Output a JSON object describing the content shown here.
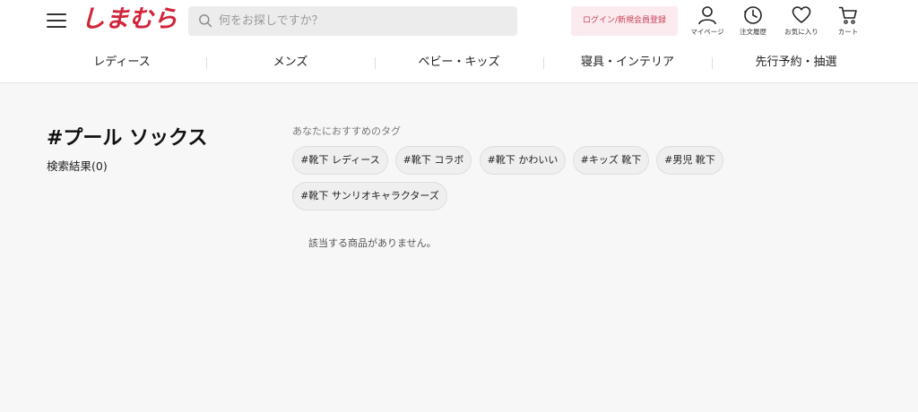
{
  "header": {
    "logo_text": "しまむら",
    "search": {
      "placeholder": "何をお探しですか？",
      "value": ""
    },
    "login_label": "ログイン/新規会員登録",
    "icons": [
      {
        "icon": "user-icon",
        "label": "マイページ"
      },
      {
        "icon": "clock-icon",
        "label": "注文履歴"
      },
      {
        "icon": "heart-icon",
        "label": "お気に入り"
      },
      {
        "icon": "cart-icon",
        "label": "カート"
      }
    ]
  },
  "nav": {
    "items": [
      "レディース",
      "メンズ",
      "ベビー・キッズ",
      "寝具・インテリア",
      "先行予約・抽選"
    ]
  },
  "main": {
    "title": "#プール ソックス",
    "result_count": "検索結果(0)",
    "recommended_heading": "あなたにおすすめのタグ",
    "tags": [
      "#靴下 レディース",
      "#靴下 コラボ",
      "#靴下 かわいい",
      "#キッズ 靴下",
      "#男児 靴下",
      "#靴下 サンリオキャラクターズ"
    ],
    "no_results": "該当する商品がありません。"
  },
  "colors": {
    "brand": "#d0263a",
    "login_bg": "#fcebee",
    "login_text": "#c9455a",
    "page_bg": "#f7f7f7"
  }
}
